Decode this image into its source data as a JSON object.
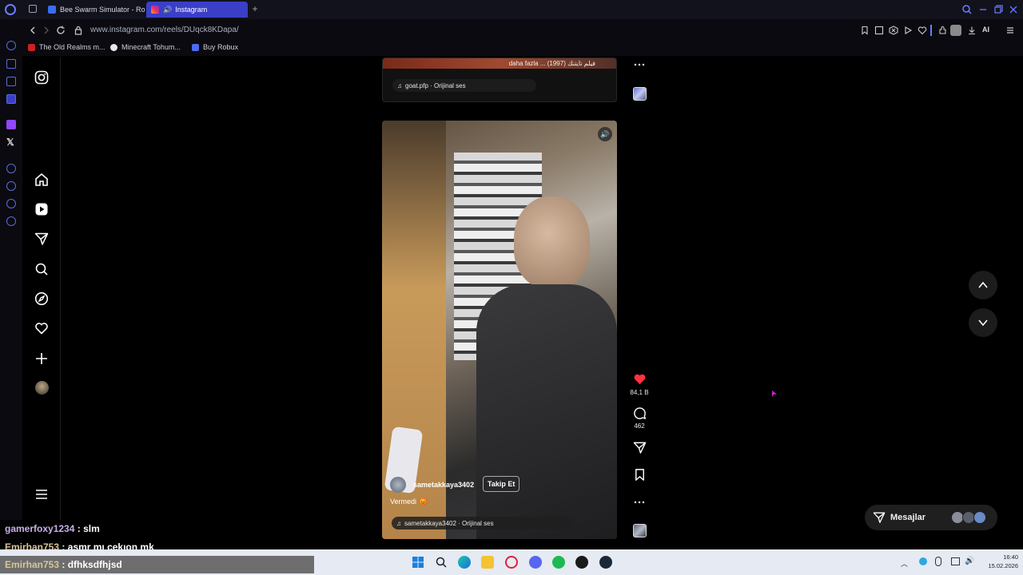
{
  "browser": {
    "tabs": [
      {
        "label": "Bee Swarm Simulator - Ro",
        "active": false
      },
      {
        "label": "Instagram",
        "active": true
      }
    ],
    "url": "www.instagram.com/reels/DUqck8KDapa/",
    "bookmarks": [
      {
        "label": "The Old Realms m..."
      },
      {
        "label": "Minecraft Tohum..."
      },
      {
        "label": "Buy Robux"
      }
    ],
    "aria_label": "AI"
  },
  "reel_prev": {
    "caption_snippet": "daha fazla ... (1997) فيلم تايتنك",
    "audio": "goat.pfp · Orijinal ses"
  },
  "reel_current": {
    "username": "sametakkaya3402",
    "follow_label": "Takip Et",
    "caption": "Vermedi 😡",
    "audio": "sametakkaya3402 · Orijinal ses",
    "likes": "84,1 B",
    "comments": "462"
  },
  "messages_button": {
    "label": "Mesajlar"
  },
  "chat": [
    {
      "user": "gamerfoxy1234",
      "text": "slm"
    },
    {
      "user": "Emirhan753",
      "text": "asmr mı çekıon mk"
    },
    {
      "user": "Emirhan753",
      "text": "dfhksdfhjsd"
    }
  ],
  "clock": {
    "time": "16:40",
    "date": "15.02.2026"
  },
  "colors": {
    "accent": "#3b3fc8",
    "like_red": "#ff3040"
  }
}
